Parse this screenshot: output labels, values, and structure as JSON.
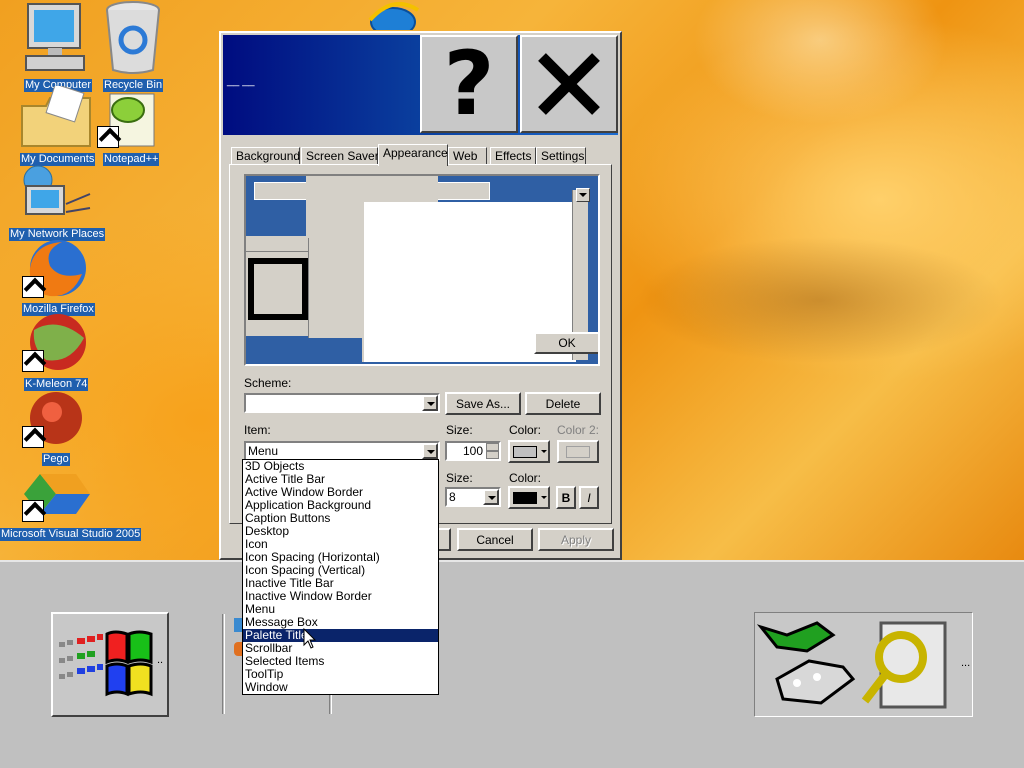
{
  "desktop": {
    "icons": [
      {
        "label": "My Computer"
      },
      {
        "label": "Recycle Bin"
      },
      {
        "label": "My Documents"
      },
      {
        "label": "Notepad++"
      },
      {
        "label": "My Network Places"
      },
      {
        "label": "Mozilla Firefox"
      },
      {
        "label": "K-Meleon 74"
      },
      {
        "label": "Pego"
      },
      {
        "label": "Microsoft Visual Studio 2005"
      }
    ]
  },
  "dialog": {
    "title": "__ __",
    "help_symbol": "?",
    "close_symbol": "X",
    "tabs": [
      "Background",
      "Screen Saver",
      "Appearance",
      "Web",
      "Effects",
      "Settings"
    ],
    "active_tab": "Appearance",
    "preview": {
      "ok_label": "OK"
    },
    "scheme": {
      "label": "Scheme:",
      "value": "",
      "save_as": "Save As...",
      "delete": "Delete"
    },
    "item": {
      "label": "Item:",
      "value": "Menu"
    },
    "size": {
      "label": "Size:",
      "value": "100"
    },
    "color": {
      "label": "Color:",
      "swatch": "#c0c0c0"
    },
    "color2": {
      "label": "Color 2:"
    },
    "font_size": {
      "label": "Size:",
      "value": "8"
    },
    "font_color": {
      "label": "Color:",
      "swatch": "#000000"
    },
    "bold_label": "B",
    "italic_label": "I",
    "buttons": {
      "cancel": "Cancel",
      "apply": "Apply"
    }
  },
  "item_dropdown": {
    "options": [
      "3D Objects",
      "Active Title Bar",
      "Active Window Border",
      "Application Background",
      "Caption Buttons",
      "Desktop",
      "Icon",
      "Icon Spacing (Horizontal)",
      "Icon Spacing (Vertical)",
      "Inactive Title Bar",
      "Inactive Window Border",
      "Menu",
      "Message Box",
      "Palette Title",
      "Scrollbar",
      "Selected Items",
      "ToolTip",
      "Window"
    ],
    "highlighted": "Palette Title"
  },
  "taskbar": {
    "start_extra": "..",
    "tray_extra": "..."
  },
  "colors": {
    "selection": "#0a246a",
    "title_start": "#000c80",
    "title_end": "#1d6cd0",
    "icon_label_bg": "#1f5fae"
  }
}
